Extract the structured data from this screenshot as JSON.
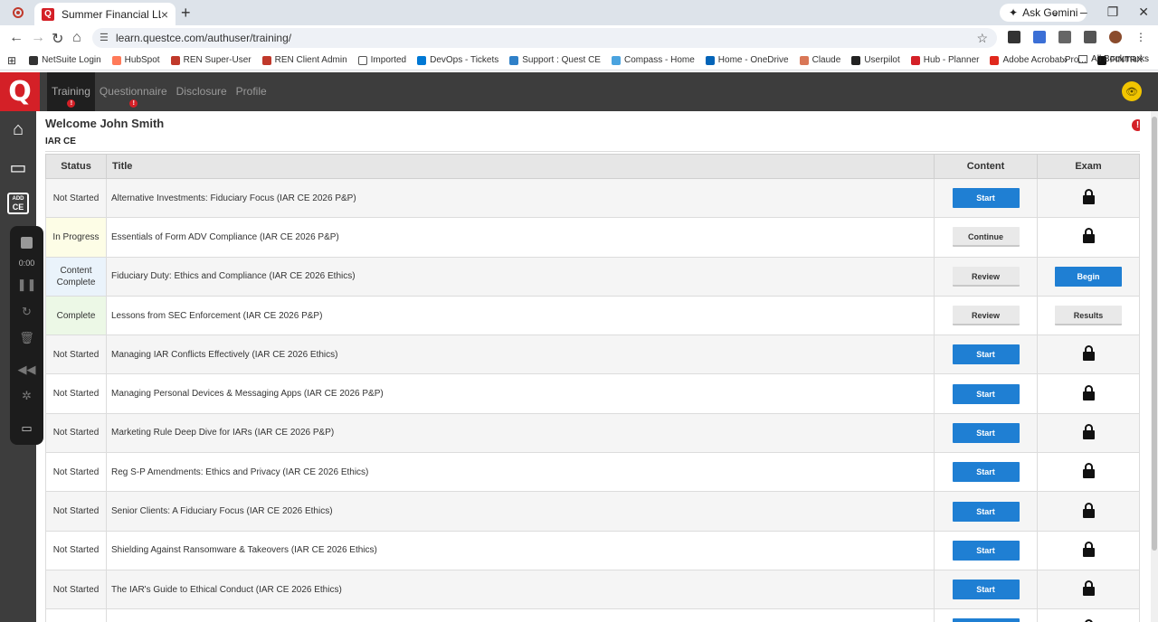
{
  "browser": {
    "tab_title": "Summer Financial LLC",
    "tab_favicon": "Q",
    "new_tab": "+",
    "ask_gemini": "Ask Gemini",
    "url": "learn.questce.com/authuser/training/",
    "bookmarks": [
      "NetSuite Login",
      "HubSpot",
      "REN Super-User",
      "REN Client Admin",
      "Imported",
      "DevOps - Tickets",
      "Support : Quest CE",
      "Compass - Home",
      "Home - OneDrive",
      "Claude",
      "Userpilot",
      "Hub - Planner",
      "Adobe Acrobat Pro...",
      "FINTRX"
    ],
    "all_bookmarks": "All Bookmarks",
    "more": "»"
  },
  "app": {
    "logo": "Q",
    "nav": [
      {
        "label": "Training",
        "active": true,
        "alert": true
      },
      {
        "label": "Questionnaire",
        "active": false,
        "alert": true
      },
      {
        "label": "Disclosure",
        "active": false,
        "alert": false
      },
      {
        "label": "Profile",
        "active": false,
        "alert": false
      }
    ],
    "alert_symbol": "!",
    "add_ce": [
      "ADD",
      "CE"
    ],
    "recorder_time": "0:00",
    "accent_color": "#d42027",
    "button_color": "#1f7fd3"
  },
  "main": {
    "welcome": "Welcome John Smith",
    "section": "IAR CE",
    "headers": {
      "status": "Status",
      "title": "Title",
      "content": "Content",
      "exam": "Exam"
    },
    "rows": [
      {
        "status": "Not Started",
        "title": "Alternative Investments: Fiduciary Focus (IAR CE 2026 P&P)",
        "content": "Start",
        "content_style": "blue",
        "exam": "locked"
      },
      {
        "status": "In Progress",
        "title": "Essentials of Form ADV Compliance (IAR CE 2026 P&P)",
        "content": "Continue",
        "content_style": "grey",
        "exam": "locked"
      },
      {
        "status": "Content Complete",
        "title": "Fiduciary Duty: Ethics and Compliance (IAR CE 2026 Ethics)",
        "content": "Review",
        "content_style": "grey",
        "exam": "Begin",
        "exam_style": "blue"
      },
      {
        "status": "Complete",
        "title": "Lessons from SEC Enforcement (IAR CE 2026 P&P)",
        "content": "Review",
        "content_style": "grey",
        "exam": "Results",
        "exam_style": "grey"
      },
      {
        "status": "Not Started",
        "title": "Managing IAR Conflicts Effectively (IAR CE 2026 Ethics)",
        "content": "Start",
        "content_style": "blue",
        "exam": "locked"
      },
      {
        "status": "Not Started",
        "title": "Managing Personal Devices & Messaging Apps (IAR CE 2026 P&P)",
        "content": "Start",
        "content_style": "blue",
        "exam": "locked"
      },
      {
        "status": "Not Started",
        "title": "Marketing Rule Deep Dive for IARs (IAR CE 2026 P&P)",
        "content": "Start",
        "content_style": "blue",
        "exam": "locked"
      },
      {
        "status": "Not Started",
        "title": "Reg S-P Amendments: Ethics and Privacy (IAR CE 2026 Ethics)",
        "content": "Start",
        "content_style": "blue",
        "exam": "locked"
      },
      {
        "status": "Not Started",
        "title": "Senior Clients: A Fiduciary Focus (IAR CE 2026 Ethics)",
        "content": "Start",
        "content_style": "blue",
        "exam": "locked"
      },
      {
        "status": "Not Started",
        "title": "Shielding Against Ransomware & Takeovers (IAR CE 2026 Ethics)",
        "content": "Start",
        "content_style": "blue",
        "exam": "locked"
      },
      {
        "status": "Not Started",
        "title": "The IAR's Guide to Ethical Conduct (IAR CE 2026 Ethics)",
        "content": "Start",
        "content_style": "blue",
        "exam": "locked"
      },
      {
        "status": "",
        "title": "",
        "content": "Start",
        "content_style": "blue",
        "exam": "locked"
      }
    ]
  }
}
